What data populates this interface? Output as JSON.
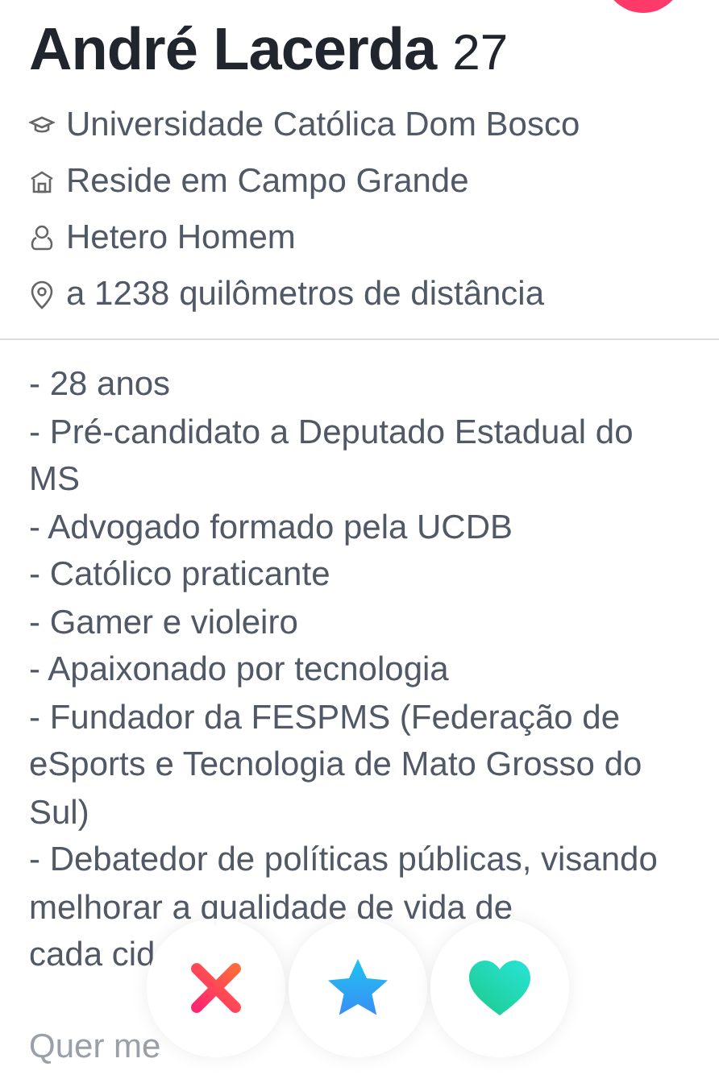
{
  "profile": {
    "name": "André Lacerda",
    "age": "27"
  },
  "details": [
    {
      "kind": "school",
      "text": "Universidade Católica Dom Bosco"
    },
    {
      "kind": "home",
      "text": "Reside em Campo Grande"
    },
    {
      "kind": "person",
      "text": "Hetero Homem"
    },
    {
      "kind": "location",
      "text": "a 1238 quilômetros de distância"
    }
  ],
  "bio": [
    "- 28 anos",
    "- Pré-candidato a Deputado Estadual do MS",
    "- Advogado formado pela UCDB",
    "- Católico praticante",
    "- Gamer e violeiro",
    "- Apaixonado por tecnologia",
    "- Fundador da FESPMS (Federação de eSports e Tecnologia de Mato Grosso do Sul)",
    "- Debatedor de políticas públicas, visando melhorar a qualidade de vida de",
    "cada cid"
  ],
  "footer_text": "Quer me",
  "actions": [
    {
      "kind": "nope"
    },
    {
      "kind": "super"
    },
    {
      "kind": "like"
    }
  ]
}
